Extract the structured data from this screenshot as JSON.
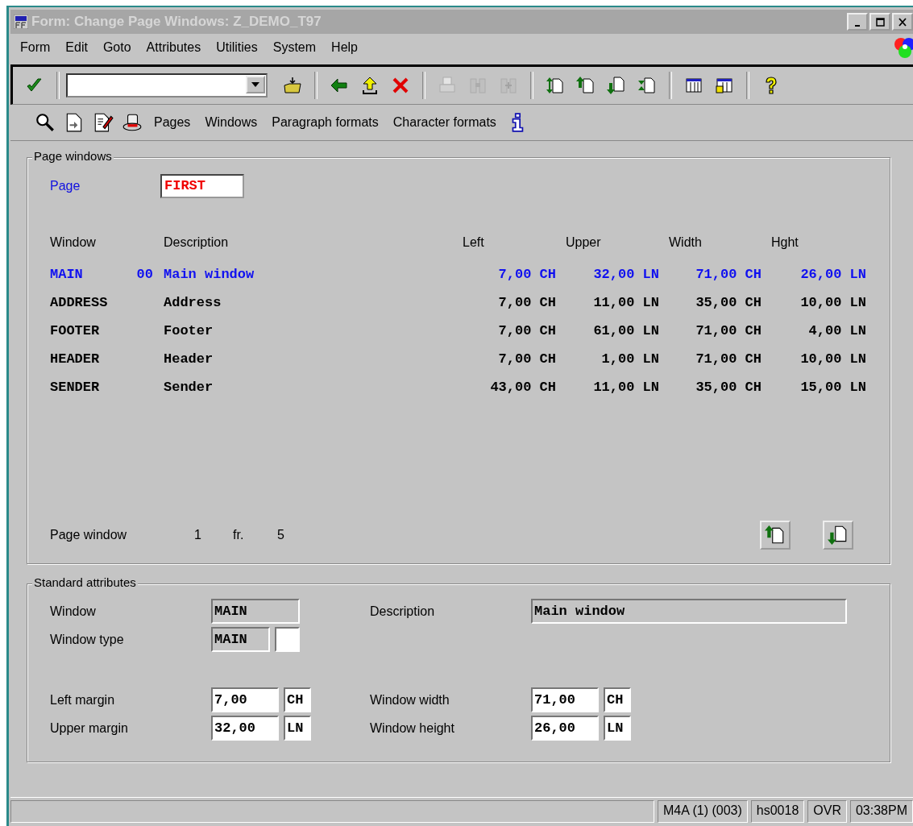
{
  "window": {
    "title": "Form: Change Page Windows: Z_DEMO_T97"
  },
  "menu": [
    "Form",
    "Edit",
    "Goto",
    "Attributes",
    "Utilities",
    "System",
    "Help"
  ],
  "toolbar": [
    {
      "kind": "check",
      "disabled": false
    },
    {
      "kind": "sep"
    },
    {
      "kind": "command-field"
    },
    {
      "kind": "folder",
      "disabled": false
    },
    {
      "kind": "sep"
    },
    {
      "kind": "back",
      "disabled": false
    },
    {
      "kind": "exit",
      "disabled": false
    },
    {
      "kind": "cancel",
      "disabled": false
    },
    {
      "kind": "sep"
    },
    {
      "kind": "print",
      "disabled": true
    },
    {
      "kind": "find",
      "disabled": true
    },
    {
      "kind": "find-next",
      "disabled": true
    },
    {
      "kind": "sep"
    },
    {
      "kind": "first-page",
      "disabled": false
    },
    {
      "kind": "prev-page",
      "disabled": false
    },
    {
      "kind": "next-page",
      "disabled": false
    },
    {
      "kind": "last-page",
      "disabled": false
    },
    {
      "kind": "sep"
    },
    {
      "kind": "session",
      "disabled": false
    },
    {
      "kind": "shortcut",
      "disabled": false
    },
    {
      "kind": "sep"
    },
    {
      "kind": "help",
      "disabled": false
    }
  ],
  "app_toolbar": [
    {
      "kind": "search"
    },
    {
      "kind": "doc-arrow"
    },
    {
      "kind": "doc-edit"
    },
    {
      "kind": "stamp"
    },
    {
      "kind": "text",
      "label": "Pages"
    },
    {
      "kind": "text",
      "label": "Windows"
    },
    {
      "kind": "text",
      "label": "Paragraph formats"
    },
    {
      "kind": "text",
      "label": "Character formats"
    },
    {
      "kind": "info"
    }
  ],
  "page_windows": {
    "title": "Page windows",
    "page_label": "Page",
    "page_value": "FIRST",
    "columns": [
      "Window",
      "Description",
      "Left",
      "Upper",
      "Width",
      "Hght"
    ],
    "rows": [
      {
        "window": "MAIN",
        "number": "00",
        "description": "Main window",
        "left": "7,00 CH",
        "upper": "32,00 LN",
        "width": "71,00 CH",
        "height": "26,00 LN",
        "selected": true
      },
      {
        "window": "ADDRESS",
        "description": "Address",
        "left": "7,00 CH",
        "upper": "11,00 LN",
        "width": "35,00 CH",
        "height": "10,00 LN",
        "selected": false
      },
      {
        "window": "FOOTER",
        "description": "Footer",
        "left": "7,00 CH",
        "upper": "61,00 LN",
        "width": "71,00 CH",
        "height": "4,00 LN",
        "selected": false
      },
      {
        "window": "HEADER",
        "description": "Header",
        "left": "7,00 CH",
        "upper": "1,00 LN",
        "width": "71,00 CH",
        "height": "10,00 LN",
        "selected": false
      },
      {
        "window": "SENDER",
        "description": "Sender",
        "left": "43,00 CH",
        "upper": "11,00 LN",
        "width": "35,00 CH",
        "height": "15,00 LN",
        "selected": false
      }
    ],
    "position": {
      "label": "Page window",
      "current": "1",
      "separator": "fr.",
      "total": "5"
    }
  },
  "standard_attributes": {
    "title": "Standard attributes",
    "rows": [
      [
        {
          "label": "Window",
          "value": "MAIN",
          "kind": "code",
          "readonly": true
        },
        {
          "label": "Description",
          "value": "Main window",
          "kind": "text",
          "readonly": true
        }
      ],
      [
        {
          "label": "Window type",
          "value": "MAIN",
          "kind": "code-box",
          "readonly": true
        }
      ],
      [
        {
          "label": "Left margin",
          "value": "7,00",
          "unit": "CH",
          "kind": "measure",
          "readonly": false
        },
        {
          "label": "Window width",
          "value": "71,00",
          "unit": "CH",
          "kind": "measure",
          "readonly": false
        }
      ],
      [
        {
          "label": "Upper margin",
          "value": "32,00",
          "unit": "LN",
          "kind": "measure",
          "readonly": false
        },
        {
          "label": "Window height",
          "value": "26,00",
          "unit": "LN",
          "kind": "measure",
          "readonly": false
        }
      ]
    ]
  },
  "status_bar": [
    "M4A (1) (003)",
    "hs0018",
    "OVR",
    "03:38PM"
  ]
}
